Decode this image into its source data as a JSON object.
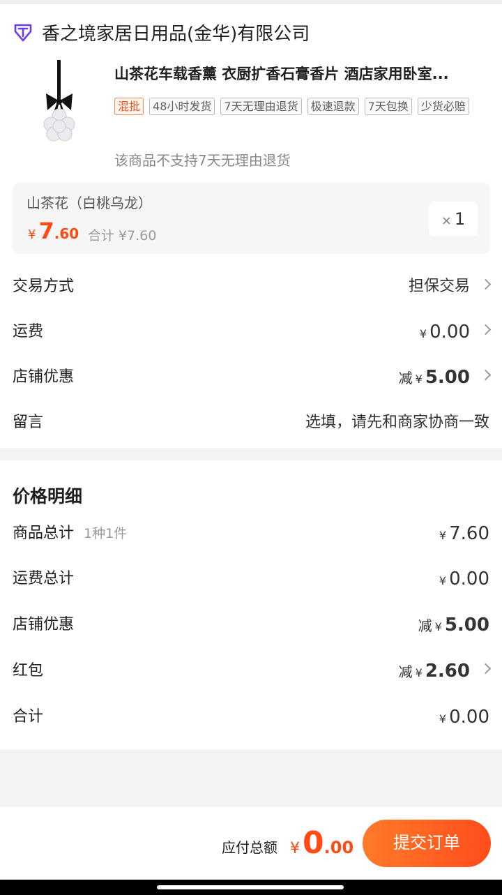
{
  "shop": {
    "name": "香之境家居日用品(金华)有限公司",
    "icon": "shop-badge-icon",
    "icon_color": "#6b3df0"
  },
  "product": {
    "title": "山茶花车载香薰 衣厨扩香石膏香片 酒店家用卧室...",
    "tags": [
      "混批",
      "48小时发货",
      "7天无理由退货",
      "极速退款",
      "7天包换",
      "少货必赔"
    ],
    "no_return_note": "该商品不支持7天无理由退货",
    "image": "camellia-aroma-pendant"
  },
  "sku": {
    "name": "山茶花（白桃乌龙）",
    "price_currency": "¥",
    "price_int": "7",
    "price_dec": ".60",
    "subtotal": "合计 ¥7.60",
    "qty_prefix": "×",
    "qty": "1"
  },
  "order_rows": {
    "trade_label": "交易方式",
    "trade_value": "担保交易",
    "shipping_label": "运费",
    "shipping_currency": "¥",
    "shipping_value": "0.00",
    "shop_discount_label": "店铺优惠",
    "shop_discount_prefix": "减",
    "shop_discount_currency": "¥",
    "shop_discount_value": "5.00",
    "message_label": "留言",
    "message_placeholder": "选填，请先和商家协商一致"
  },
  "price_detail": {
    "title": "价格明细",
    "goods_label": "商品总计",
    "goods_count": "1种1件",
    "goods_currency": "¥",
    "goods_value": "7.60",
    "shipping_label": "运费总计",
    "shipping_currency": "¥",
    "shipping_value": "0.00",
    "shop_discount_label": "店铺优惠",
    "shop_discount_prefix": "减",
    "shop_discount_currency": "¥",
    "shop_discount_value": "5.00",
    "redpacket_label": "红包",
    "redpacket_prefix": "减",
    "redpacket_currency": "¥",
    "redpacket_value": "2.60",
    "total_label": "合计",
    "total_currency": "¥",
    "total_value": "0.00"
  },
  "footer": {
    "due_label": "应付总额",
    "due_currency": "¥",
    "due_int": "0",
    "due_dec": ".00",
    "submit_label": "提交订单"
  },
  "colors": {
    "accent": "#ff4a13",
    "discount": "#f0531e",
    "button_start": "#ff7a2a",
    "button_end": "#ff4d1a"
  }
}
